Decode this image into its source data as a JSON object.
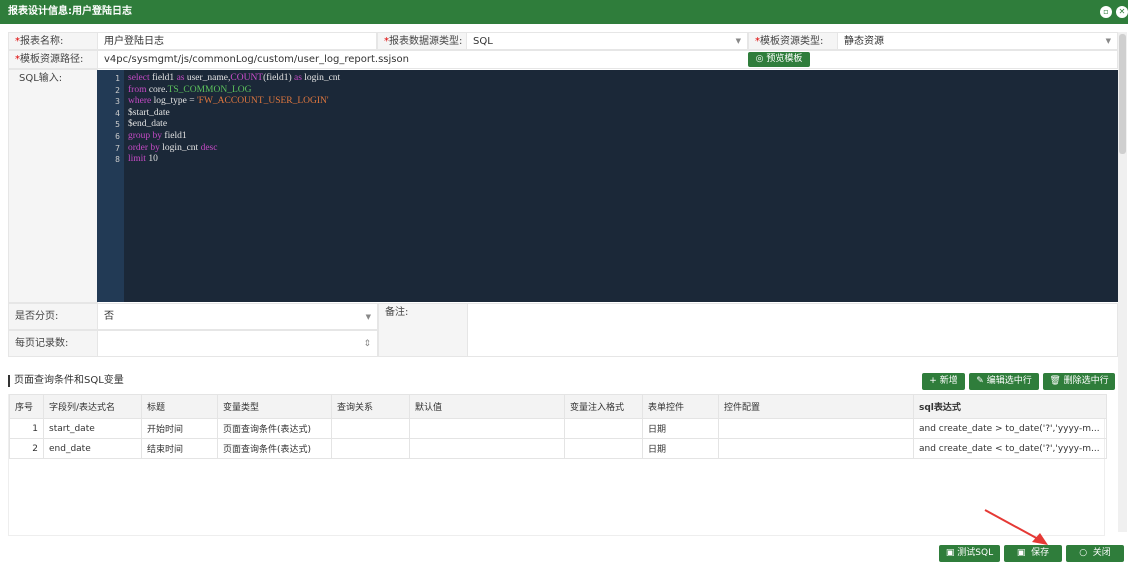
{
  "window": {
    "title": "报表设计信息:用户登陆日志",
    "restore_icon": "restore-icon",
    "close_icon": "close-icon"
  },
  "form": {
    "report_name_label": "报表名称:",
    "report_name": "用户登陆日志",
    "datasource_type_label": "报表数据源类型:",
    "datasource_type": "SQL",
    "template_type_label": "模板资源类型:",
    "template_type": "静态资源",
    "template_path_label": "模板资源路径:",
    "template_path": "v4pc/sysmgmt/js/commonLog/custom/user_log_report.ssjson",
    "preview_button": "预览模板",
    "sql_label": "SQL输入:",
    "paging_label": "是否分页:",
    "paging": "否",
    "page_size_label": "每页记录数:",
    "page_size": "",
    "remark_label": "备注:",
    "remark": ""
  },
  "sql_lines": [
    "1",
    "2",
    "3",
    "4",
    "5",
    "6",
    "7",
    "8"
  ],
  "sql": {
    "l1": [
      "select",
      " field1 ",
      "as",
      " user_name,",
      "COUNT",
      "(field1) ",
      "as",
      " login_cnt"
    ],
    "l2": [
      "from",
      " core.",
      "TS_COMMON_LOG"
    ],
    "l3": [
      "where",
      " log_type = ",
      "'FW_ACCOUNT_USER_LOGIN'"
    ],
    "l4": "$start_date",
    "l5": "$end_date",
    "l6": [
      "group by",
      " field1"
    ],
    "l7": [
      "order by",
      " login_cnt ",
      "desc"
    ],
    "l8": [
      "limit",
      " 10"
    ]
  },
  "section": {
    "title": "页面查询条件和SQL变量",
    "add": "新增",
    "edit": "编辑选中行",
    "delete": "删除选中行"
  },
  "table": {
    "headers": [
      "序号",
      "字段列/表达式名",
      "标题",
      "变量类型",
      "查询关系",
      "默认值",
      "变量注入格式",
      "表单控件",
      "控件配置",
      "sql表达式"
    ],
    "rows": [
      [
        "1",
        "start_date",
        "开始时间",
        "页面查询条件(表达式)",
        "",
        "",
        "",
        "日期",
        "",
        "and create_date > to_date('?','yyyy-m..."
      ],
      [
        "2",
        "end_date",
        "结束时间",
        "页面查询条件(表达式)",
        "",
        "",
        "",
        "日期",
        "",
        "and create_date < to_date('?','yyyy-m..."
      ]
    ]
  },
  "footer": {
    "test_sql": "测试SQL",
    "save": "保存",
    "close": "关闭"
  },
  "colors": {
    "brand": "#2f7d3b",
    "editor_bg": "#1b2838",
    "arrow": "#e53935"
  }
}
